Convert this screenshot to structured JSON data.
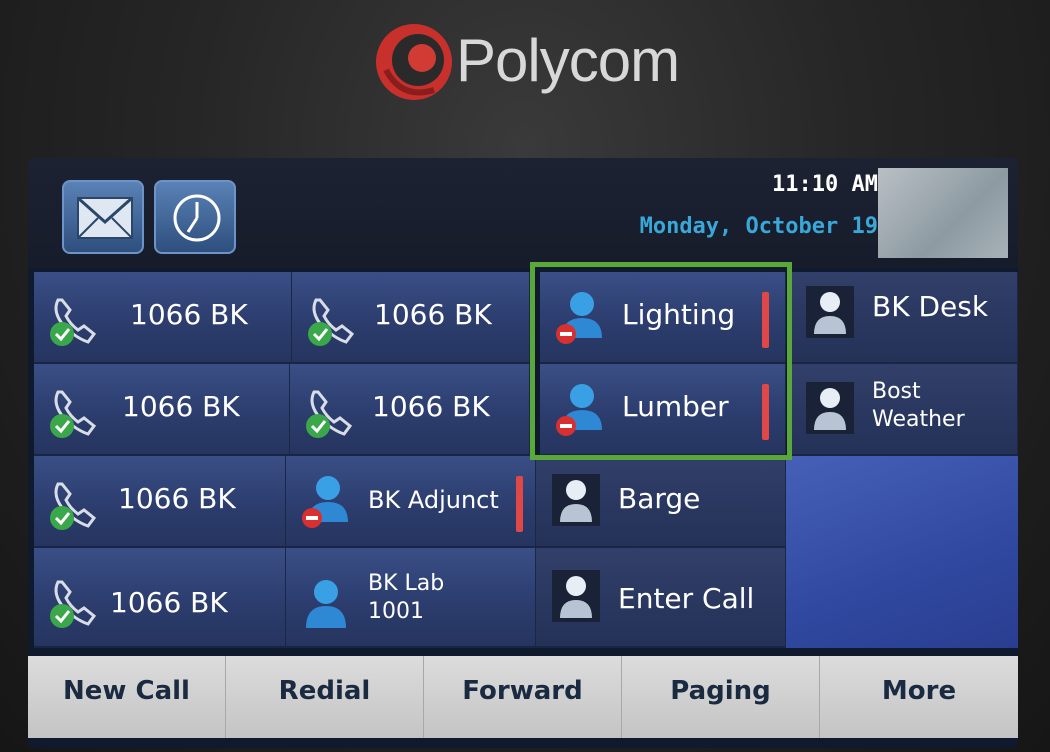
{
  "brand": {
    "name": "Polycom",
    "accent": "#e0403a"
  },
  "status": {
    "time": "11:10 AM",
    "date": "Monday, October 19",
    "mail_icon": "mail-icon",
    "clock_icon": "clock-icon"
  },
  "line_keys": [
    {
      "label": "1066 BK",
      "icon": "phone-check-icon"
    },
    {
      "label": "1066 BK",
      "icon": "phone-check-icon"
    },
    {
      "label": "Lighting",
      "icon": "contact-busy-icon"
    },
    {
      "label": "BK Desk",
      "icon": "contact-icon"
    },
    {
      "label": "1066 BK",
      "icon": "phone-check-icon"
    },
    {
      "label": "1066 BK",
      "icon": "phone-check-icon"
    },
    {
      "label": "Lumber",
      "icon": "contact-busy-icon"
    },
    {
      "label_line1": "Bost",
      "label_line2": "Weather",
      "icon": "contact-icon"
    },
    {
      "label": "1066 BK",
      "icon": "phone-check-icon"
    },
    {
      "label": "BK Adjunct",
      "icon": "contact-busy-icon"
    },
    {
      "label": "Barge",
      "icon": "contact-icon"
    },
    {
      "label": "1066 BK",
      "icon": "phone-check-icon"
    },
    {
      "label_line1": "BK Lab",
      "label_line2": "1001",
      "icon": "contact-online-icon"
    },
    {
      "label": "Enter Call",
      "icon": "contact-icon"
    }
  ],
  "soft_keys": [
    "New Call",
    "Redial",
    "Forward",
    "Paging",
    "More"
  ],
  "colors": {
    "busy_indicator": "#e04848",
    "highlight": "#5aa83a",
    "date_text": "#39a8d8"
  }
}
